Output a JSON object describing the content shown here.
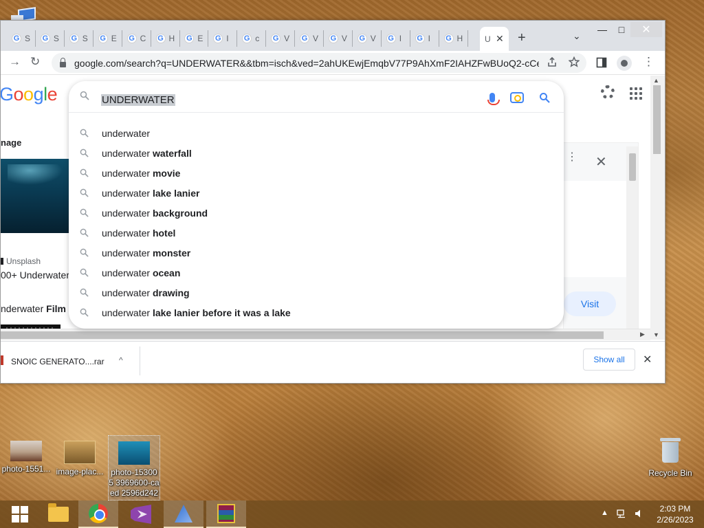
{
  "browser": {
    "tabs": [
      {
        "favicon": "G",
        "label": "S"
      },
      {
        "favicon": "G",
        "label": "S"
      },
      {
        "favicon": "G",
        "label": "S"
      },
      {
        "favicon": "G",
        "label": "E"
      },
      {
        "favicon": "G",
        "label": "C"
      },
      {
        "favicon": "G",
        "label": "H"
      },
      {
        "favicon": "G",
        "label": "E"
      },
      {
        "favicon": "G",
        "label": "I"
      },
      {
        "favicon": "G",
        "label": "c"
      },
      {
        "favicon": "G",
        "label": "V"
      },
      {
        "favicon": "G",
        "label": "V"
      },
      {
        "favicon": "G",
        "label": "V"
      },
      {
        "favicon": "G",
        "label": "V"
      },
      {
        "favicon": "G",
        "label": "I"
      },
      {
        "favicon": "G",
        "label": "I"
      },
      {
        "favicon": "G",
        "label": "H"
      }
    ],
    "active_tab": {
      "label": "U",
      "close": "✕"
    },
    "new_tab": "+",
    "tab_search": "⌄",
    "window_controls": {
      "minimize": "—",
      "maximize": "□",
      "close": "✕"
    },
    "nav": {
      "forward": "→",
      "reload": "↻"
    },
    "url": "google.com/search?q=UNDERWATER&&tbm=isch&ved=2ahUKEwjEmqbV77P9AhXmF2IAHZFwBUoQ2-cCe...",
    "omnibox_icons": [
      "share-icon",
      "star-icon"
    ],
    "side_panel_icon": "side-panel-icon",
    "menu_icon": "⋮"
  },
  "google": {
    "logo_letters": [
      "G",
      "o",
      "o",
      "g",
      "l",
      "e"
    ],
    "search_query": "UNDERWATER",
    "suggestion_prefix": "underwater",
    "suggestions": [
      {
        "prefix": "underwater",
        "bold": ""
      },
      {
        "prefix": "underwater",
        "bold": "waterfall"
      },
      {
        "prefix": "underwater",
        "bold": "movie"
      },
      {
        "prefix": "underwater",
        "bold": "lake lanier"
      },
      {
        "prefix": "underwater",
        "bold": "background"
      },
      {
        "prefix": "underwater",
        "bold": "hotel"
      },
      {
        "prefix": "underwater",
        "bold": "monster"
      },
      {
        "prefix": "underwater",
        "bold": "ocean"
      },
      {
        "prefix": "underwater",
        "bold": "drawing"
      },
      {
        "prefix": "underwater",
        "bold": "lake lanier before it was a lake"
      }
    ],
    "left_column": {
      "title": "nage",
      "source": "Unsplash",
      "caption": "00+ Underwater",
      "film_prefix": "nderwater ",
      "film_bold": "Film"
    },
    "right_panel": {
      "visit": "Visit",
      "close": "✕",
      "more": "⋮"
    }
  },
  "downloads": {
    "filename": "SNOIC GENERATO....rar",
    "caret": "^",
    "show_all": "Show all",
    "close": "✕"
  },
  "desktop": {
    "icons": [
      {
        "label": "photo-1551..."
      },
      {
        "label": "image-plac..."
      },
      {
        "label": "photo-153005 3969600-caed 2596d242"
      }
    ],
    "recycle_bin": "Recycle Bin"
  },
  "taskbar": {
    "apps": [
      "windows-start",
      "file-explorer",
      "chrome",
      "visual-studio",
      "app-installer",
      "winrar"
    ],
    "clock": {
      "time": "2:03 PM",
      "date": "2/26/2023"
    }
  }
}
